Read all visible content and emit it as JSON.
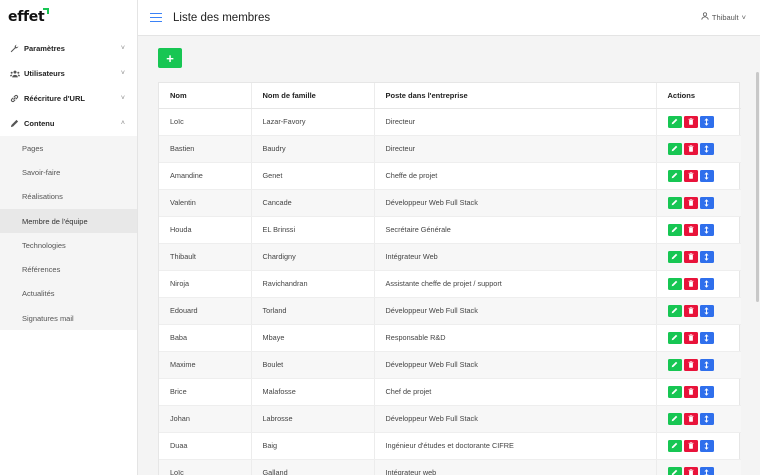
{
  "brand": {
    "logo_text": "effet"
  },
  "sidebar": {
    "items": [
      {
        "label": "Paramètres",
        "icon": "wrench-icon",
        "chevron": "˅"
      },
      {
        "label": "Utilisateurs",
        "icon": "users-icon",
        "chevron": "˅"
      },
      {
        "label": "Réécriture d'URL",
        "icon": "link-icon",
        "chevron": "˅"
      },
      {
        "label": "Contenu",
        "icon": "pencil-icon",
        "chevron": "˄"
      }
    ],
    "sub_items": [
      {
        "label": "Pages"
      },
      {
        "label": "Savoir-faire"
      },
      {
        "label": "Réalisations"
      },
      {
        "label": "Membre de l'équipe",
        "active": true
      },
      {
        "label": "Technologies"
      },
      {
        "label": "Références"
      },
      {
        "label": "Actualités"
      },
      {
        "label": "Signatures mail"
      }
    ]
  },
  "header": {
    "title": "Liste des membres",
    "user": "Thibault",
    "user_chevron": "˅"
  },
  "toolbar": {
    "add_label": "+"
  },
  "table": {
    "columns": [
      "Nom",
      "Nom de famille",
      "Poste dans l'entreprise",
      "Actions"
    ],
    "rows": [
      {
        "first": "Loïc",
        "last": "Lazar-Favory",
        "role": "Directeur"
      },
      {
        "first": "Bastien",
        "last": "Baudry",
        "role": "Directeur"
      },
      {
        "first": "Amandine",
        "last": "Genet",
        "role": "Cheffe de projet"
      },
      {
        "first": "Valentin",
        "last": "Cancade",
        "role": "Développeur Web Full Stack"
      },
      {
        "first": "Houda",
        "last": "EL Brinssi",
        "role": "Secrétaire Générale"
      },
      {
        "first": "Thibault",
        "last": "Chardigny",
        "role": "Intégrateur Web"
      },
      {
        "first": "Niroja",
        "last": "Ravichandran",
        "role": "Assistante cheffe de projet / support"
      },
      {
        "first": "Edouard",
        "last": "Torland",
        "role": "Développeur Web Full Stack"
      },
      {
        "first": "Baba",
        "last": "Mbaye",
        "role": "Responsable R&D"
      },
      {
        "first": "Maxime",
        "last": "Boulet",
        "role": "Développeur Web Full Stack"
      },
      {
        "first": "Brice",
        "last": "Malafosse",
        "role": "Chef de projet"
      },
      {
        "first": "Johan",
        "last": "Labrosse",
        "role": "Développeur Web Full Stack"
      },
      {
        "first": "Duaa",
        "last": "Baig",
        "role": "Ingénieur d'études et doctorante CIFRE"
      },
      {
        "first": "Loïc",
        "last": "Galland",
        "role": "Intégrateur web"
      }
    ]
  },
  "colors": {
    "accent": "#17c653",
    "danger": "#e8133a",
    "primary": "#2f6fec",
    "menu_icon": "#3b82f6"
  }
}
